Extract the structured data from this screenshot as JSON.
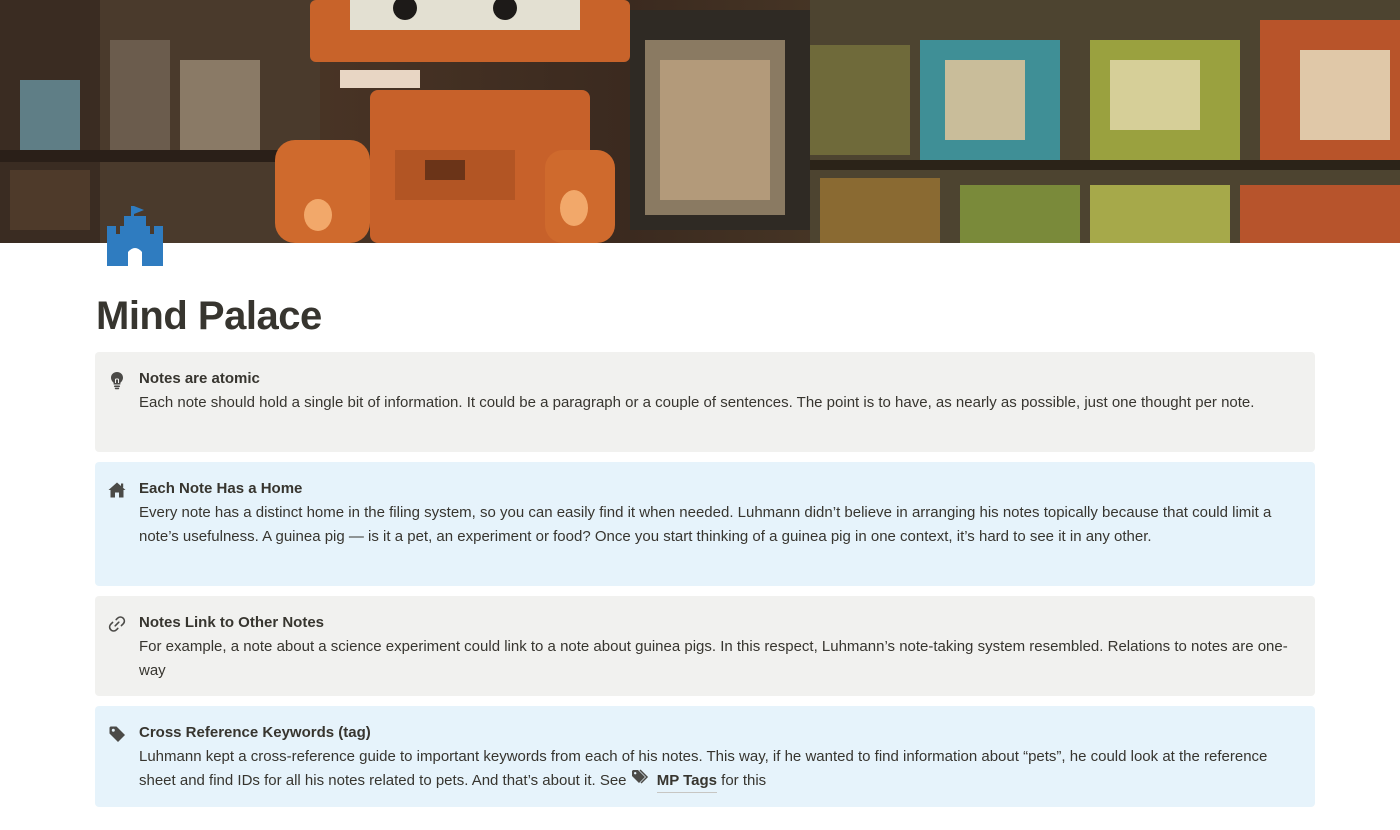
{
  "page": {
    "title": "Mind Palace",
    "icon": "castle-icon",
    "cover": "robot-filing-cabinets-illustration"
  },
  "colors": {
    "gray_callout": "#f1f1ef",
    "blue_callout": "#e6f3fb",
    "icon_blue": "#2f7cc0",
    "text": "#37352f"
  },
  "callouts": [
    {
      "icon": "lightbulb-icon",
      "title": "Notes are atomic",
      "body": "Each note should hold a single bit of information. It could be a paragraph or a couple of sentences. The point is to have, as nearly as possible, just one thought per note."
    },
    {
      "icon": "home-icon",
      "title": "Each Note Has a Home",
      "body": "Every note has a distinct home in the filing system, so you can easily find it when needed. Luhmann didn’t believe in arranging his notes topically because that could limit a note’s usefulness. A guinea pig — is it a pet, an experiment or food? Once you start thinking of a guinea pig in one context, it’s hard to see it in any other."
    },
    {
      "icon": "link-icon",
      "title": "Notes Link to Other Notes",
      "body": "For example, a note about a science experiment could link to a note about guinea pigs. In this respect, Luhmann’s note-taking system resembled. Relations to notes are one-way"
    },
    {
      "icon": "tag-icon",
      "title": "Cross Reference Keywords (tag)",
      "body": "Luhmann kept a cross-reference guide to important keywords from each of his notes. This way, if he wanted to find information about “pets”, he could look at the reference sheet and find IDs for all his notes related to pets. And that’s about it.  See",
      "mention_icon": "tags-icon",
      "mention_label": "MP Tags",
      "after_mention": " for this"
    }
  ]
}
